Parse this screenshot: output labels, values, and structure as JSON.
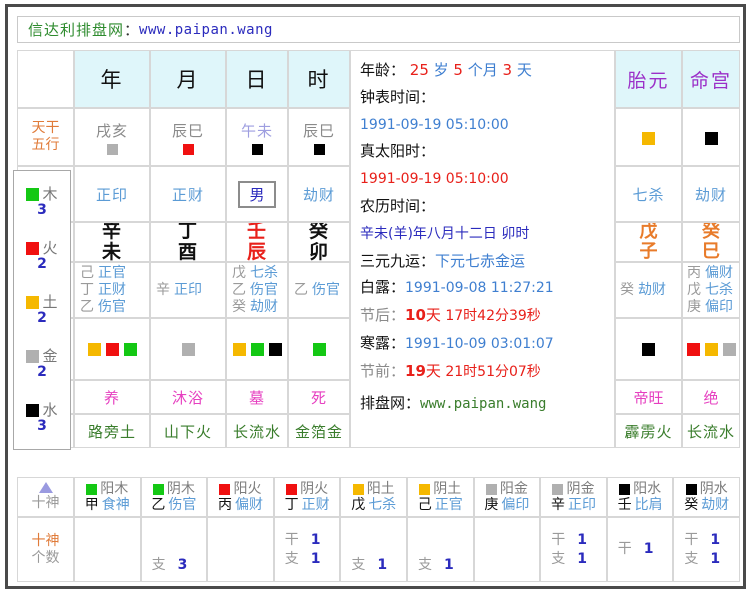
{
  "title": {
    "cn": "信达利排盘网",
    "colon": "：",
    "url": "www.paipan.wang"
  },
  "columns": {
    "corner_line1": "天干",
    "corner_line2": "五行",
    "headers": [
      "年",
      "月",
      "日",
      "时"
    ]
  },
  "kongwang": [
    {
      "text": "戌亥",
      "color": "#b0b0b0",
      "purple": false
    },
    {
      "text": "辰巳",
      "color": "#f01010",
      "purple": false
    },
    {
      "text": "午未",
      "color": "#000000",
      "purple": true
    },
    {
      "text": "辰巳",
      "color": "#000000",
      "purple": false
    }
  ],
  "tengods_row": [
    "正印",
    "正财",
    "劫财"
  ],
  "sex_label": "男",
  "pillars": [
    {
      "gan": "辛",
      "zhi": "未",
      "red": false
    },
    {
      "gan": "丁",
      "zhi": "酉",
      "red": false
    },
    {
      "gan": "壬",
      "zhi": "辰",
      "red": true
    },
    {
      "gan": "癸",
      "zhi": "卯",
      "red": false
    }
  ],
  "hidden_stems": [
    [
      {
        "stem": "己",
        "god": "正官"
      },
      {
        "stem": "丁",
        "god": "正财"
      },
      {
        "stem": "乙",
        "god": "伤官"
      }
    ],
    [
      {
        "stem": "辛",
        "god": "正印"
      }
    ],
    [
      {
        "stem": "戊",
        "god": "七杀"
      },
      {
        "stem": "乙",
        "god": "伤官"
      },
      {
        "stem": "癸",
        "god": "劫财"
      }
    ],
    [
      {
        "stem": "乙",
        "god": "伤官"
      }
    ]
  ],
  "element_squares": [
    [
      "#f5b800",
      "#f01010",
      "#14c814"
    ],
    [
      "#b0b0b0"
    ],
    [
      "#f5b800",
      "#14c814",
      "#000000"
    ],
    [
      "#14c814"
    ]
  ],
  "life_stages": [
    "养",
    "沐浴",
    "墓",
    "死"
  ],
  "nayin": [
    "路旁土",
    "山下火",
    "长流水",
    "金箔金"
  ],
  "info": {
    "age": {
      "label": "年龄：",
      "years": "25",
      "y_unit": "岁",
      "months": "5",
      "m_unit": "个月",
      "days": "3",
      "d_unit": "天"
    },
    "clock_label": "钟表时间：",
    "clock_value": "1991-09-19 05:10:00",
    "solar_label": "真太阳时：",
    "solar_value": "1991-09-19 05:10:00",
    "lunar_label": "农历时间：",
    "lunar_value": "辛未(羊)年八月十二日 卯时",
    "sanyuan_label": "三元九运：",
    "sanyuan_value": "下元七赤金运",
    "bailu_label": "白露：",
    "bailu_value": "1991-09-08 11:27:21",
    "after_label": "节后：",
    "after_days": "10",
    "after_days_unit": "天",
    "after_rest": "17时42分39秒",
    "hanlu_label": "寒露：",
    "hanlu_value": "1991-10-09 03:01:07",
    "before_label": "节前：",
    "before_days": "19",
    "before_days_unit": "天",
    "before_rest": "21时51分07秒",
    "footer_label": "排盘网：",
    "footer_url": "www.paipan.wang"
  },
  "right": {
    "headers": [
      "胎元",
      "命宫"
    ],
    "squares": [
      "#f5b800",
      "#000000"
    ],
    "tengods": [
      "七杀",
      "劫财"
    ],
    "pillars": [
      {
        "gan": "戊",
        "zhi": "子"
      },
      {
        "gan": "癸",
        "zhi": "巳"
      }
    ],
    "hidden_stems": [
      [
        {
          "stem": "癸",
          "god": "劫财"
        }
      ],
      [
        {
          "stem": "丙",
          "god": "偏财"
        },
        {
          "stem": "戊",
          "god": "七杀"
        },
        {
          "stem": "庚",
          "god": "偏印"
        }
      ]
    ],
    "element_squares": [
      [
        "#000000"
      ],
      [
        "#f01010",
        "#f5b800",
        "#b0b0b0"
      ]
    ],
    "life_stages": [
      "帝旺",
      "绝"
    ],
    "nayin": [
      "霹雳火",
      "长流水"
    ]
  },
  "five_elements": [
    {
      "name": "木",
      "count": "3",
      "color": "#14c814"
    },
    {
      "name": "火",
      "count": "2",
      "color": "#f01010"
    },
    {
      "name": "土",
      "count": "2",
      "color": "#f5b800"
    },
    {
      "name": "金",
      "count": "2",
      "color": "#b0b0b0"
    },
    {
      "name": "水",
      "count": "3",
      "color": "#000000"
    }
  ],
  "bottom": {
    "row1_label": "十神",
    "row2_label_line1": "十神",
    "row2_label_line2": "个数",
    "gan_key": "干",
    "zhi_key": "支",
    "items": [
      {
        "yy": "阳木",
        "color": "#14c814",
        "stem": "甲",
        "god": "食神",
        "gan": "",
        "zhi": ""
      },
      {
        "yy": "阴木",
        "color": "#14c814",
        "stem": "乙",
        "god": "伤官",
        "gan": "",
        "zhi": "3"
      },
      {
        "yy": "阳火",
        "color": "#f01010",
        "stem": "丙",
        "god": "偏财",
        "gan": "",
        "zhi": ""
      },
      {
        "yy": "阴火",
        "color": "#f01010",
        "stem": "丁",
        "god": "正财",
        "gan": "1",
        "zhi": "1"
      },
      {
        "yy": "阳土",
        "color": "#f5b800",
        "stem": "戊",
        "god": "七杀",
        "gan": "",
        "zhi": "1"
      },
      {
        "yy": "阴土",
        "color": "#f5b800",
        "stem": "己",
        "god": "正官",
        "gan": "",
        "zhi": "1"
      },
      {
        "yy": "阳金",
        "color": "#b0b0b0",
        "stem": "庚",
        "god": "偏印",
        "gan": "",
        "zhi": ""
      },
      {
        "yy": "阴金",
        "color": "#b0b0b0",
        "stem": "辛",
        "god": "正印",
        "gan": "1",
        "zhi": "1"
      },
      {
        "yy": "阳水",
        "color": "#000000",
        "stem": "壬",
        "god": "比肩",
        "gan": "1",
        "zhi": ""
      },
      {
        "yy": "阴水",
        "color": "#000000",
        "stem": "癸",
        "god": "劫财",
        "gan": "1",
        "zhi": "1"
      }
    ]
  }
}
